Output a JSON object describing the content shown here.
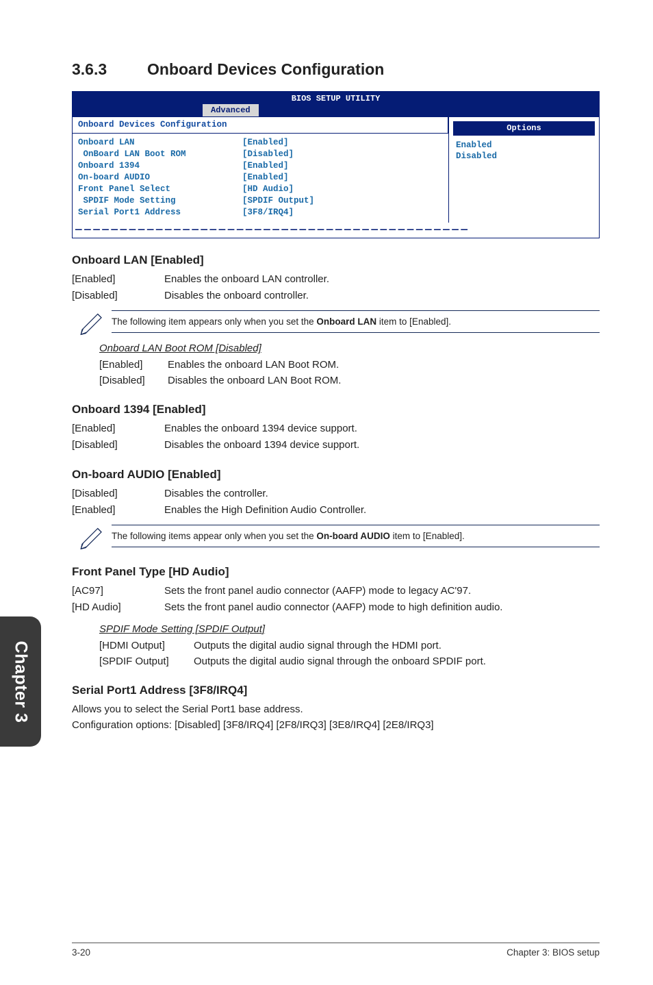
{
  "heading": {
    "num": "3.6.3",
    "title": "Onboard Devices Configuration"
  },
  "bios": {
    "title": "BIOS SETUP UTILITY",
    "tab": "Advanced",
    "group_title": "Onboard Devices Configuration",
    "rows": [
      {
        "label": "Onboard LAN",
        "value": "[Enabled]"
      },
      {
        "label": " OnBoard LAN Boot ROM",
        "value": "[Disabled]"
      },
      {
        "label": "Onboard 1394",
        "value": "[Enabled]"
      },
      {
        "label": "On-board AUDIO",
        "value": "[Enabled]"
      },
      {
        "label": "Front Panel Select",
        "value": "[HD Audio]"
      },
      {
        "label": " SPDIF Mode Setting",
        "value": "[SPDIF Output]"
      },
      {
        "label": "Serial Port1 Address",
        "value": "[3F8/IRQ4]"
      }
    ],
    "options_header": "Options",
    "options": [
      "Enabled",
      "Disabled"
    ]
  },
  "sections": {
    "lan": {
      "title": "Onboard LAN [Enabled]",
      "enabled": "Enables the onboard LAN controller.",
      "disabled": "Disables the onboard controller.",
      "note": "The following item appears only when you set the ",
      "note_bold": "Onboard LAN",
      "note_tail": " item to [Enabled].",
      "sub_title": "Onboard LAN Boot ROM [Disabled]",
      "sub_en": "Enables the onboard LAN Boot ROM.",
      "sub_dis": "Disables the onboard LAN Boot ROM."
    },
    "ob1394": {
      "title": "Onboard 1394 [Enabled]",
      "enabled": "Enables the onboard 1394 device support.",
      "disabled": "Disables the onboard 1394 device support."
    },
    "audio": {
      "title": "On-board AUDIO [Enabled]",
      "disabled": "Disables the controller.",
      "enabled": "Enables the High Definition Audio Controller.",
      "note": "The following items appear only when you set the ",
      "note_bold": "On-board AUDIO",
      "note_tail": " item to [Enabled]."
    },
    "front": {
      "title": "Front Panel Type [HD Audio]",
      "ac97": "Sets the front panel audio connector (AAFP) mode to legacy AC'97.",
      "hd": "Sets the front panel audio connector (AAFP) mode to high definition audio.",
      "sub_title": "SPDIF Mode Setting [SPDIF Output]",
      "hdmi": "Outputs the digital audio signal through the HDMI port.",
      "spdif": "Outputs the digital audio signal through the onboard SPDIF port."
    },
    "serial": {
      "title": "Serial Port1 Address [3F8/IRQ4]",
      "l1": "Allows you to select the Serial Port1 base address.",
      "l2": "Configuration options: [Disabled] [3F8/IRQ4] [2F8/IRQ3] [3E8/IRQ4] [2E8/IRQ3]"
    }
  },
  "labels": {
    "enabled": "[Enabled]",
    "disabled": "[Disabled]",
    "ac97": "[AC97]",
    "hdaudio": "[HD Audio]",
    "hdmi_out": "[HDMI Output]",
    "spdif_out": "[SPDIF Output]"
  },
  "sidetab": "Chapter 3",
  "footer": {
    "left": "3-20",
    "right": "Chapter 3: BIOS setup"
  }
}
